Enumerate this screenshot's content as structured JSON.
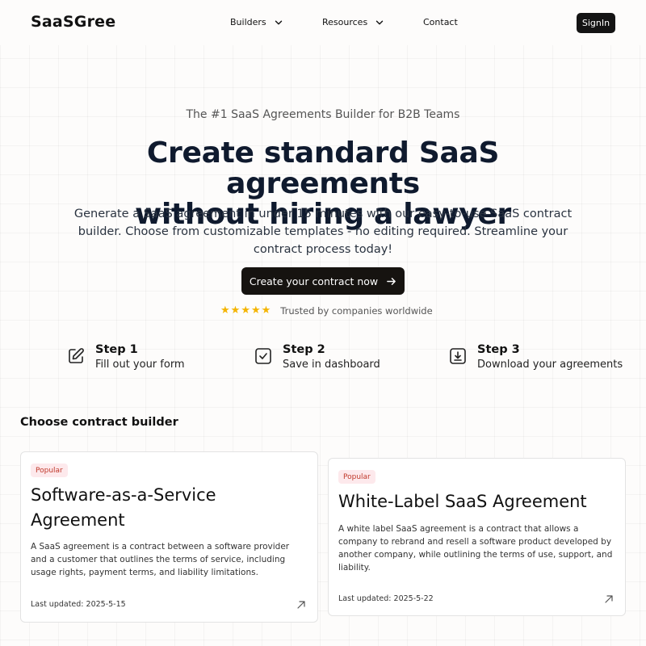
{
  "header": {
    "logo": "SaaSGree",
    "nav": [
      {
        "label": "Builders"
      },
      {
        "label": "Resources"
      },
      {
        "label": "Contact"
      }
    ],
    "signin_label": "SignIn"
  },
  "hero": {
    "tagline": "The #1 SaaS Agreements Builder for B2B Teams",
    "title_line1": "Create standard SaaS agreements",
    "title_line2": "without hiring a lawyer",
    "subtitle": "Generate a SaaS agreement in under 15 minutes with our easy-to-use SaaS contract builder. Choose from customizable templates - no editing required. Streamline your contract process today!",
    "cta_label": "Create your contract now",
    "rating_stars": 5,
    "trust_text": "Trusted by companies worldwide"
  },
  "steps": [
    {
      "title": "Step 1",
      "desc": "Fill out your form",
      "icon": "edit-icon"
    },
    {
      "title": "Step 2",
      "desc": "Save in dashboard",
      "icon": "checkbox-icon"
    },
    {
      "title": "Step 3",
      "desc": "Download your agreements",
      "icon": "download-icon"
    }
  ],
  "builders": {
    "section_title": "Choose contract builder",
    "cards": [
      {
        "badge": "Popular",
        "title": "Software-as-a-Service Agreement",
        "desc": "A SaaS agreement is a contract between a software provider and a customer that outlines the terms of service, including usage rights, payment terms, and liability limitations.",
        "date": "Last updated: 2025-5-15"
      },
      {
        "badge": "Popular",
        "title": "White-Label SaaS Agreement",
        "desc": "A white label SaaS agreement is a contract that allows a company to rebrand and resell a software product developed by another company, while outlining the terms of use, support, and liability.",
        "date": "Last updated: 2025-5-22"
      }
    ]
  },
  "colors": {
    "primary_button": "#161310",
    "star": "#f4b400",
    "badge_bg": "#fde9ec",
    "badge_text": "#c0392b",
    "title": "#0f1a2e"
  }
}
